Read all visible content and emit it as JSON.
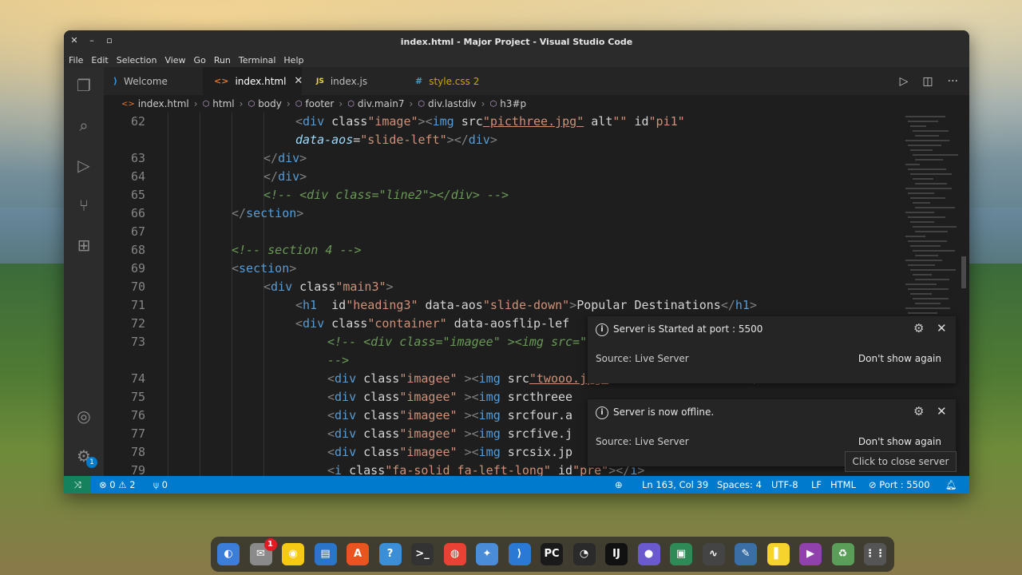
{
  "window": {
    "title": "index.html - Major Project - Visual Studio Code",
    "menu": [
      "File",
      "Edit",
      "Selection",
      "View",
      "Go",
      "Run",
      "Terminal",
      "Help"
    ]
  },
  "tabs": [
    {
      "icon": "vscode-icon",
      "label": "Welcome",
      "active": false
    },
    {
      "icon": "<>",
      "label": "index.html",
      "active": true
    },
    {
      "icon": "JS",
      "label": "index.js",
      "active": false
    },
    {
      "icon": "#",
      "label": "style.css 2",
      "active": false
    }
  ],
  "breadcrumb": [
    "index.html",
    "html",
    "body",
    "footer",
    "div.main7",
    "div.lastdiv",
    "h3#p"
  ],
  "code_lines": [
    {
      "n": "62",
      "text": "<div class=\"image\"><img src=\"picthree.jpg\" alt=\"\" id=\"pi1\""
    },
    {
      "n": "",
      "text": "data-aos=\"slide-left\"></div>"
    },
    {
      "n": "63",
      "text": "</div>"
    },
    {
      "n": "64",
      "text": "</div>"
    },
    {
      "n": "65",
      "text": "<!-- <div class=\"line2\"></div> -->"
    },
    {
      "n": "66",
      "text": "</section>"
    },
    {
      "n": "67",
      "text": ""
    },
    {
      "n": "68",
      "text": "<!-- section 4 -->"
    },
    {
      "n": "69",
      "text": "<section>"
    },
    {
      "n": "70",
      "text": "<div class=\"main3\">"
    },
    {
      "n": "71",
      "text": "<h1  id=\"heading3\" data-aos=\"slide-down\">Popular Destinations</h1>"
    },
    {
      "n": "72",
      "text": "<div class=\"container\" data-aos=\"flip-lef"
    },
    {
      "n": "73",
      "text": "<!-- <div class=\"imagee\" ><img src=\"o"
    },
    {
      "n": "",
      "text": "-->"
    },
    {
      "n": "74",
      "text": "<div class=\"imagee\" ><img src=\"twooo.jpg\" alt=\"\" width=\"100%\"></div>"
    },
    {
      "n": "75",
      "text": "<div class=\"imagee\" ><img src=\"threee"
    },
    {
      "n": "76",
      "text": "<div class=\"imagee\" ><img src=\"four.a"
    },
    {
      "n": "77",
      "text": "<div class=\"imagee\" ><img src=\"five.j"
    },
    {
      "n": "78",
      "text": "<div class=\"imagee\" ><img src=\"six.jp"
    },
    {
      "n": "79",
      "text": "<i class=\"fa-solid fa-left-long\" id=\"pre\"></i>"
    }
  ],
  "notifications": [
    {
      "message": "Server is Started at port : 5500",
      "source": "Source: Live Server",
      "action": "Don't show again"
    },
    {
      "message": "Server is now offline.",
      "source": "Source: Live Server",
      "action": "Don't show again"
    }
  ],
  "tooltip": "Click to close server",
  "statusbar": {
    "errors": "0",
    "warnings": "2",
    "ports": "0",
    "position": "Ln 163, Col 39",
    "spaces": "Spaces: 4",
    "encoding": "UTF-8",
    "eol": "LF",
    "language": "HTML",
    "port": "Port : 5500"
  },
  "activity_badge": "1",
  "dock": {
    "mail_badge": "1",
    "items": [
      "files-icon",
      "mail-icon",
      "rhythmbox-icon",
      "writer-icon",
      "software-icon",
      "help-icon",
      "terminal-icon",
      "chrome-icon",
      "extensions-icon",
      "vscode-icon",
      "pycharm-icon",
      "obs-icon",
      "intellij-icon",
      "screen-recorder-icon",
      "gpu-icon",
      "system-monitor-icon",
      "text-editor-icon",
      "notes-icon",
      "video-icon",
      "trash-icon",
      "apps-grid-icon"
    ]
  },
  "colors": {
    "statusbar": "#007acc",
    "remote": "#16825d",
    "editor_bg": "#1e1e1e"
  }
}
